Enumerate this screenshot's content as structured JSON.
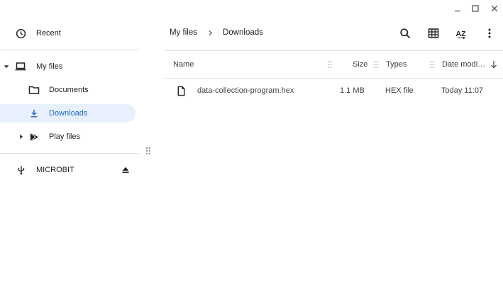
{
  "window": {
    "minimize_icon": "minimize-icon",
    "maximize_icon": "maximize-icon",
    "close_icon": "close-icon"
  },
  "sidebar": {
    "recent": {
      "label": "Recent",
      "icon": "clock-icon"
    },
    "my_files": {
      "label": "My files",
      "icon": "laptop-icon",
      "expanded": true
    },
    "documents": {
      "label": "Documents",
      "icon": "folder-icon"
    },
    "downloads": {
      "label": "Downloads",
      "icon": "download-icon",
      "selected": true
    },
    "play_files": {
      "label": "Play files",
      "icon": "play-icon",
      "expanded": false
    },
    "microbit": {
      "label": "MICROBIT",
      "icon": "usb-icon",
      "eject_icon": "eject-icon"
    }
  },
  "breadcrumb": [
    "My files",
    "Downloads"
  ],
  "toolbar": {
    "search_icon": "search-icon",
    "grid_icon": "grid-view-icon",
    "sort_icon": "sort-az-icon",
    "more_icon": "more-vertical-icon"
  },
  "columns": {
    "name": "Name",
    "size": "Size",
    "types": "Types",
    "date": "Date modi…"
  },
  "files": [
    {
      "name": "data-collection-program.hex",
      "size": "1.1 MB",
      "type": "HEX file",
      "date": "Today 11:07",
      "icon": "file-icon"
    }
  ],
  "colors": {
    "accent": "#1967d2",
    "selected_bg": "#e8f0fe",
    "text": "#202124",
    "divider": "#e0e0e0"
  }
}
